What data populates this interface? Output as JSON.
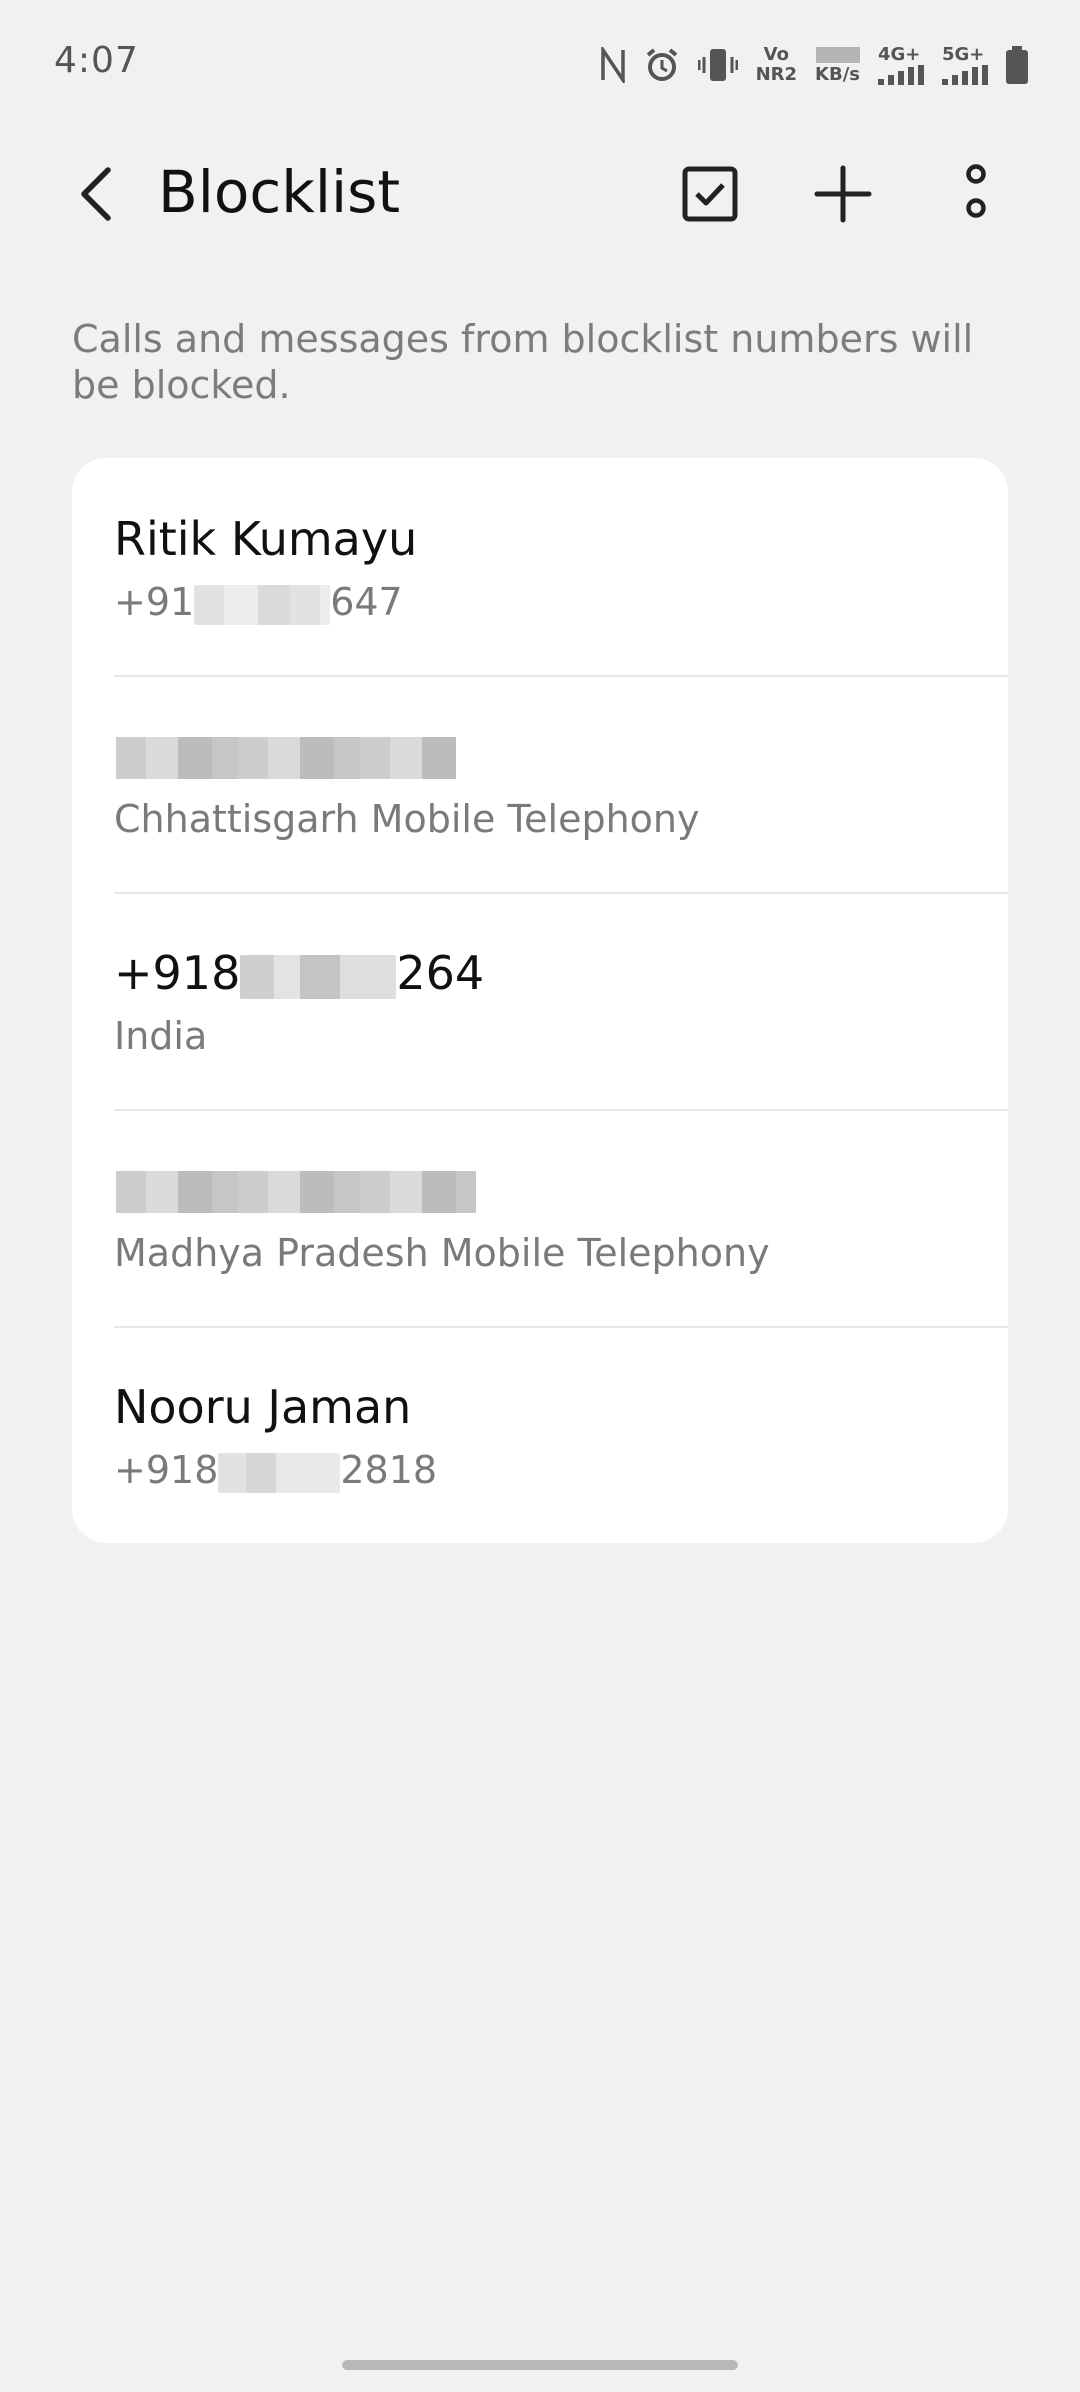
{
  "status_bar": {
    "time": "4:07",
    "icons": [
      "nfc-icon",
      "alarm-icon",
      "vibrate-icon",
      "volte-icon",
      "network-speed-icon",
      "signal-4g-icon",
      "signal-5g-icon",
      "battery-icon"
    ],
    "volte_top": "Vo",
    "volte_bottom": "NR2",
    "speed_unit": "KB/s",
    "sim1_label": "4G+",
    "sim2_label": "5G+"
  },
  "header": {
    "title": "Blocklist",
    "back_icon": "chevron-left-icon",
    "select_icon": "checkbox-icon",
    "add_icon": "plus-icon",
    "more_icon": "more-vertical-icon"
  },
  "description": "Calls and messages from blocklist numbers will be blocked.",
  "blocklist": [
    {
      "primary_pre": "Ritik Kumayu",
      "secondary_pre": "+91",
      "secondary_post": "647",
      "secondary_redacted": true
    },
    {
      "primary_redacted": true,
      "secondary": "Chhattisgarh Mobile Telephony"
    },
    {
      "primary_pre": "+918",
      "primary_post": "264",
      "primary_redacted_mid": true,
      "secondary": "India"
    },
    {
      "primary_redacted": true,
      "secondary": "Madhya Pradesh Mobile Telephony"
    },
    {
      "primary_pre": "Nooru Jaman",
      "secondary_pre": "+918",
      "secondary_post": "2818",
      "secondary_redacted": true
    }
  ]
}
